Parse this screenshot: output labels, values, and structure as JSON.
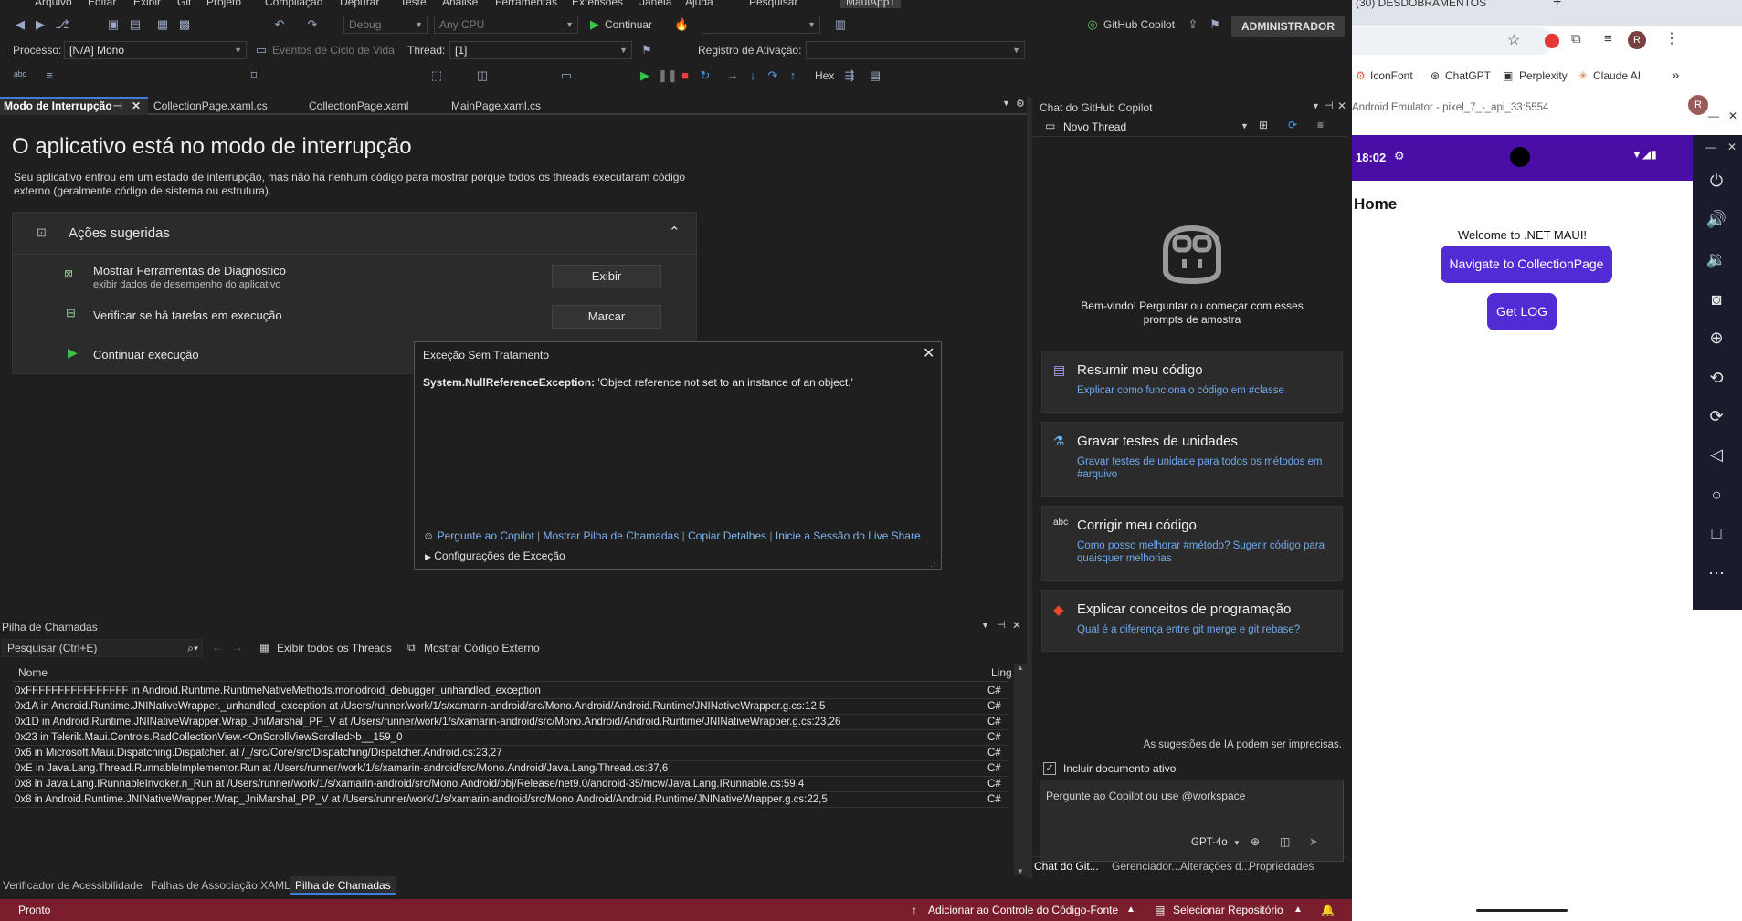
{
  "vs": {
    "menu": [
      "Arquivo",
      "Editar",
      "Exibir",
      "Git",
      "Projeto",
      "Compilação",
      "Depurar",
      "Teste",
      "Análise",
      "Ferramentas",
      "Extensões",
      "Janela",
      "Ajuda",
      "Pesquisar",
      "MauiApp1"
    ],
    "toolbar": {
      "config": "Debug",
      "platform": "Any CPU",
      "continue_label": "Continuar",
      "copilot_label": "GitHub Copilot",
      "admin_label": "ADMINISTRADOR",
      "process_label": "Processo:",
      "process_value": "[N/A] Mono",
      "lifecycle_label": "Eventos de Ciclo de Vida",
      "thread_label": "Thread:",
      "thread_value": "[1]",
      "activation_label": "Registro de Ativação:",
      "hex_label": "Hex"
    },
    "tabs": [
      {
        "label": "Modo de Interrupção"
      },
      {
        "label": "CollectionPage.xaml.cs"
      },
      {
        "label": "CollectionPage.xaml"
      },
      {
        "label": "MainPage.xaml.cs"
      }
    ],
    "breakmode": {
      "title": "O aplicativo está no modo de interrupção",
      "description": "Seu aplicativo entrou em um estado de interrupção, mas não há nenhum código para mostrar porque todos os threads executaram código externo (geralmente código de sistema ou estrutura).",
      "actions_title": "Ações sugeridas",
      "action1_title": "Mostrar Ferramentas de Diagnóstico",
      "action1_sub": "exibir dados de desempenho do aplicativo",
      "action1_button": "Exibir",
      "action2_title": "Verificar se há tarefas em execução",
      "action2_button": "Marcar",
      "action3_title": "Continuar execução"
    },
    "exception": {
      "title": "Exceção Sem Tratamento",
      "type": "System.NullReferenceException:",
      "message": " 'Object reference not set to an instance of an object.'",
      "link1": "Pergunte ao Copilot",
      "link2": "Mostrar Pilha de Chamadas",
      "link3": "Copiar Detalhes",
      "link4": "Inicie a Sessão do Live Share",
      "settings": "Configurações de Exceção"
    },
    "callstack": {
      "title": "Pilha de Chamadas",
      "search_placeholder": "Pesquisar (Ctrl+E)",
      "show_threads": "Exibir todos os Threads",
      "show_external": "Mostrar Código Externo",
      "col_name": "Nome",
      "col_lang": "Ling",
      "rows": [
        {
          "name": "0xFFFFFFFFFFFFFFFF in Android.Runtime.RuntimeNativeMethods.monodroid_debugger_unhandled_exception",
          "lang": "C#"
        },
        {
          "name": "0x1A in Android.Runtime.JNINativeWrapper._unhandled_exception at /Users/runner/work/1/s/xamarin-android/src/Mono.Android/Android.Runtime/JNINativeWrapper.g.cs:12,5",
          "lang": "C#"
        },
        {
          "name": "0x1D in Android.Runtime.JNINativeWrapper.Wrap_JniMarshal_PP_V at /Users/runner/work/1/s/xamarin-android/src/Mono.Android/Android.Runtime/JNINativeWrapper.g.cs:23,26",
          "lang": "C#"
        },
        {
          "name": "0x23 in Telerik.Maui.Controls.RadCollectionView.<OnScrollViewScrolled>b__159_0",
          "lang": "C#"
        },
        {
          "name": "0x6 in Microsoft.Maui.Dispatching.Dispatcher. at /_/src/Core/src/Dispatching/Dispatcher.Android.cs:23,27",
          "lang": "C#"
        },
        {
          "name": "0xE in Java.Lang.Thread.RunnableImplementor.Run at /Users/runner/work/1/s/xamarin-android/src/Mono.Android/Java.Lang/Thread.cs:37,6",
          "lang": "C#"
        },
        {
          "name": "0x8 in Java.Lang.IRunnableInvoker.n_Run at /Users/runner/work/1/s/xamarin-android/src/Mono.Android/obj/Release/net9.0/android-35/mcw/Java.Lang.IRunnable.cs:59,4",
          "lang": "C#"
        },
        {
          "name": "0x8 in Android.Runtime.JNINativeWrapper.Wrap_JniMarshal_PP_V at /Users/runner/work/1/s/xamarin-android/src/Mono.Android/Android.Runtime/JNINativeWrapper.g.cs:22,5",
          "lang": "C#"
        }
      ]
    },
    "bottom_tabs": [
      "Verificador de Acessibilidade",
      "Falhas de Associação XAML",
      "Pilha de Chamadas"
    ],
    "status": {
      "ready": "Pronto",
      "source_control": "Adicionar ao Controle do Código-Fonte",
      "repo": "Selecionar Repositório"
    }
  },
  "copilot": {
    "panel_title": "Chat do GitHub Copilot",
    "thread": "Novo Thread",
    "welcome": "Bem-vindo! Perguntar ou começar com esses prompts de amostra",
    "cards": [
      {
        "title": "Resumir meu código",
        "sub": "Explicar como funciona o código em #classe"
      },
      {
        "title": "Gravar testes de unidades",
        "sub": "Gravar testes de unidade para todos os métodos em #arquivo"
      },
      {
        "title": "Corrigir meu código",
        "sub": "Como posso melhorar #método? Sugerir código para quaisquer melhorias"
      },
      {
        "title": "Explicar conceitos de programação",
        "sub": "Qual é a diferença entre git merge e git rebase?"
      }
    ],
    "disclaimer": "As sugestões de IA podem ser imprecisas.",
    "include_doc": "Incluir documento ativo",
    "input_placeholder": "Pergunte ao Copilot ou use @workspace",
    "model": "GPT-4o",
    "tabs": [
      "Chat do Git...",
      "Gerenciador...",
      "Alterações d...",
      "Propriedades"
    ]
  },
  "browser": {
    "tab_title": "(30) DESDOBRAMENTOS",
    "bookmarks": [
      "IconFont",
      "ChatGPT",
      "Perplexity",
      "Claude AI"
    ],
    "emulator_title": "Android Emulator - pixel_7_-_api_33:5554",
    "avatar_letter": "R"
  },
  "android": {
    "time": "18:02",
    "page_title": "Home",
    "welcome": "Welcome to .NET MAUI!",
    "nav_button": "Navigate to CollectionPage",
    "log_button": "Get LOG"
  },
  "colors": {
    "accent": "#3c7dd9",
    "status_bar": "#7a1e2e",
    "maui_purple": "#512bd4",
    "android_bar": "#4a0ea7",
    "link": "#6fa8ee"
  }
}
